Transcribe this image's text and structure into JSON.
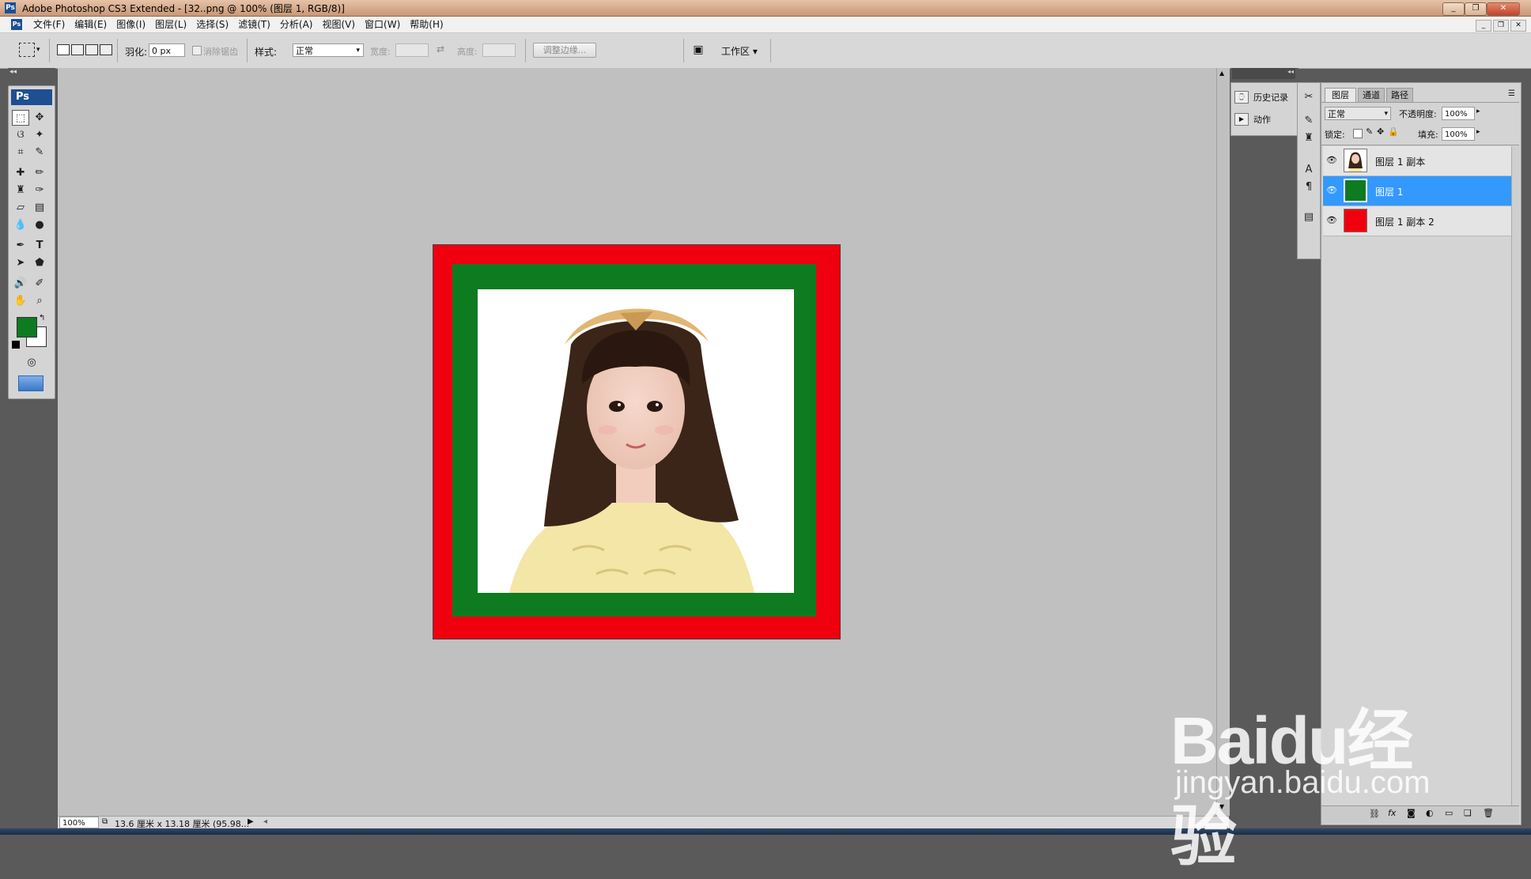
{
  "window": {
    "title": "Adobe Photoshop CS3 Extended - [32..png @ 100% (图层 1, RGB/8)]",
    "logo": "Ps",
    "controls": [
      "_",
      "❐",
      "✕"
    ]
  },
  "menu": {
    "items": [
      "文件(F)",
      "编辑(E)",
      "图像(I)",
      "图层(L)",
      "选择(S)",
      "滤镜(T)",
      "分析(A)",
      "视图(V)",
      "窗口(W)",
      "帮助(H)"
    ]
  },
  "options": {
    "feather_label": "羽化:",
    "feather_value": "0 px",
    "antialias_label": "消除锯齿",
    "style_label": "样式:",
    "style_value": "正常",
    "width_label": "宽度:",
    "height_label": "高度:",
    "refine_edge_label": "调整边缘...",
    "workspace_label": "工作区 ▾"
  },
  "toolbox": {
    "header": "Ps",
    "foreground_color": "#0e7b20",
    "background_color": "#ffffff"
  },
  "document": {
    "outer_color": "#f0000f",
    "middle_color": "#0e7b20",
    "inner_color": "#ffffff"
  },
  "status": {
    "zoom": "100%",
    "doc_info": "13.6 厘米 x 13.18 厘米 (95.98..."
  },
  "mini_panel": {
    "items": [
      {
        "label": "历史记录",
        "icon": "history-icon"
      },
      {
        "label": "动作",
        "icon": "actions-play-icon"
      }
    ]
  },
  "layers_panel": {
    "tabs": [
      "图层",
      "通道",
      "路径"
    ],
    "blend_mode": "正常",
    "opacity_label": "不透明度:",
    "opacity_value": "100%",
    "lock_label": "锁定:",
    "fill_label": "填充:",
    "fill_value": "100%",
    "layers": [
      {
        "name": "图层 1 副本",
        "thumb": "photo",
        "selected": false
      },
      {
        "name": "图层 1",
        "thumb": "#0e7b20",
        "selected": true
      },
      {
        "name": "图层 1 副本 2",
        "thumb": "#f0000f",
        "selected": false
      }
    ]
  },
  "watermark": {
    "line1": "Baidu经验",
    "line2": "jingyan.baidu.com"
  }
}
